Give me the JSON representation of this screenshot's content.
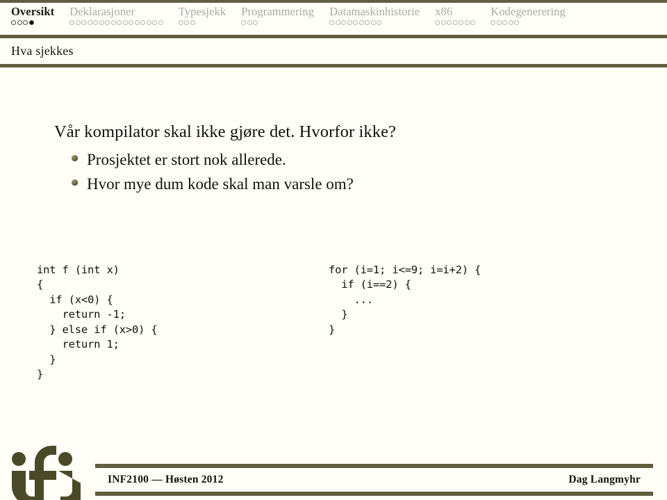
{
  "header": {
    "nav_sections": [
      {
        "label": "Oversikt",
        "dots": 4,
        "active": true,
        "filled_index": 3
      },
      {
        "label": "Deklarasjoner",
        "dots": 16,
        "active": false,
        "filled_index": -1
      },
      {
        "label": "Typesjekk",
        "dots": 3,
        "active": false,
        "filled_index": -1
      },
      {
        "label": "Programmering",
        "dots": 3,
        "active": false,
        "filled_index": -1
      },
      {
        "label": "Datamaskinhistorie",
        "dots": 9,
        "active": false,
        "filled_index": -1
      },
      {
        "label": "x86",
        "dots": 7,
        "active": false,
        "filled_index": -1
      },
      {
        "label": "Kodegenerering",
        "dots": 5,
        "active": false,
        "filled_index": -1
      }
    ],
    "subtitle": "Hva sjekkes"
  },
  "main": {
    "lead": "Vår kompilator skal ikke gjøre det. Hvorfor ikke?",
    "bullets": [
      "Prosjektet er stort nok allerede.",
      "Hvor mye dum kode skal man varsle om?"
    ],
    "code_left": "int f (int x)\n{\n  if (x<0) {\n    return -1;\n  } else if (x>0) {\n    return 1;\n  }\n}",
    "code_right": "for (i=1; i<=9; i=i+2) {\n  if (i==2) {\n    ...\n  }\n}"
  },
  "footer": {
    "course": "INF2100 — Høsten 2012",
    "author": "Dag Langmyhr",
    "logo_alt": "ifi-logo"
  },
  "colors": {
    "olive": "#5f5f3f",
    "page_background": "#fffff8",
    "nav_inactive_text": "#a9a9a9",
    "nav_active_text": "#1a1a14",
    "body_text": "#111108",
    "bullet_marker": "#5a5a3a"
  }
}
